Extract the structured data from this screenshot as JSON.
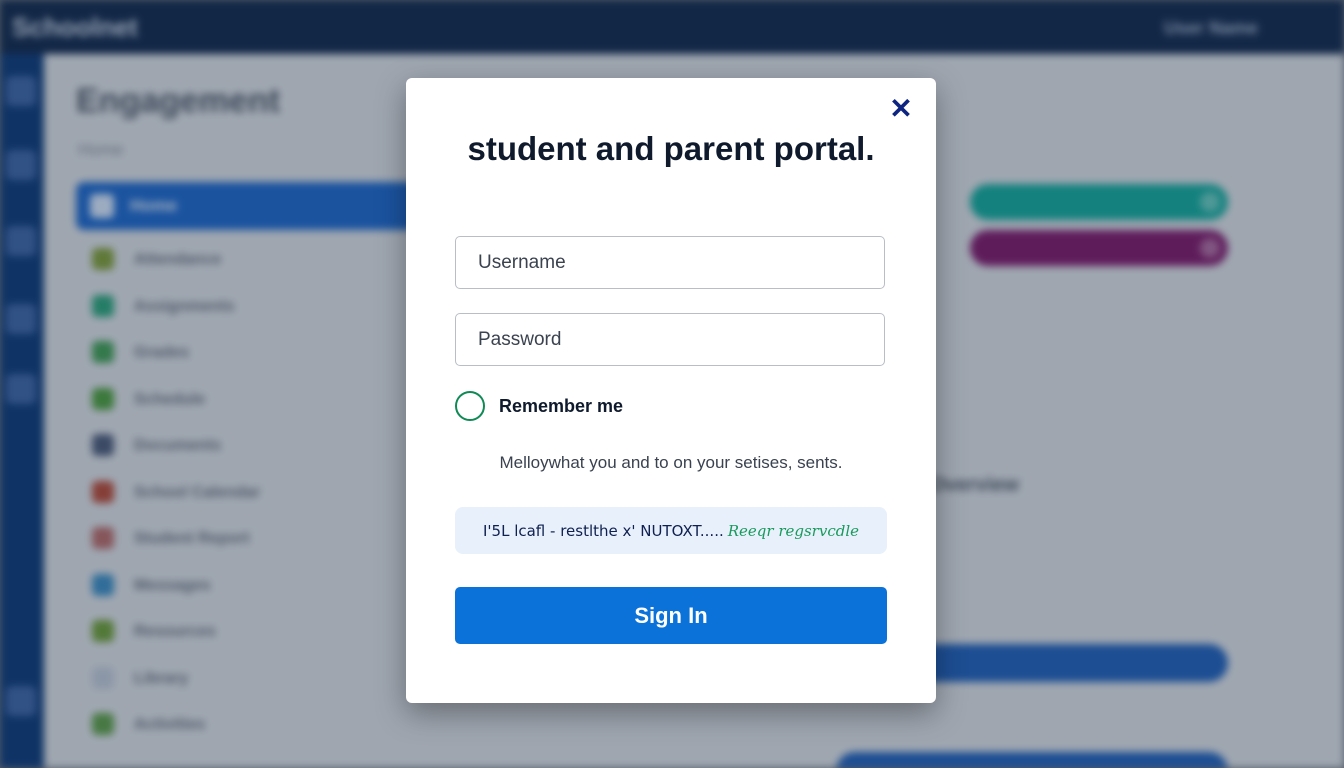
{
  "background_app": {
    "brand": "Schoolnet",
    "user_menu": "User  Name",
    "page_heading": "Engagement",
    "page_subheading": "Home",
    "nav_active_label": "Home",
    "nav_items": [
      {
        "label": "Attendance",
        "icon_color": "#7c9a3a"
      },
      {
        "label": "Assignments",
        "icon_color": "#2aa07a"
      },
      {
        "label": "Grades",
        "icon_color": "#3f9a55"
      },
      {
        "label": "Schedule",
        "icon_color": "#4a9a3f"
      },
      {
        "label": "Documents",
        "icon_color": "#4a5a78"
      },
      {
        "label": "School Calendar",
        "icon_color": "#b04a3a"
      },
      {
        "label": "Student Report",
        "icon_color": "#b06a6a"
      },
      {
        "label": "Messages",
        "icon_color": "#3a8ac0"
      },
      {
        "label": "Resources",
        "icon_color": "#6a9a3a"
      },
      {
        "label": "Library",
        "icon_color": "#b8c4d4"
      },
      {
        "label": "Activities",
        "icon_color": "#5a9a4a"
      }
    ],
    "side_label": "Overview",
    "pill_colors": {
      "teal": "#12a69a",
      "purple": "#7a1a6a",
      "blue": "#1f5fb7"
    }
  },
  "login": {
    "close_icon": "close-icon",
    "title": "student and parent portal.",
    "username_placeholder": "Username",
    "password_placeholder": "Password",
    "remember_label": "Remember me",
    "note": "Melloywhat you and to on your setises, sents.",
    "banner_text": "I'5L lcafl - restlthe x' NUTOXT.....",
    "banner_link": "Reeqr regsrvcdle",
    "signin_label": "Sign In",
    "colors": {
      "primary": "#0b72d9",
      "remember_ring": "#0f8a55",
      "link": "#1a9a5c",
      "close": "#0d2580"
    }
  }
}
